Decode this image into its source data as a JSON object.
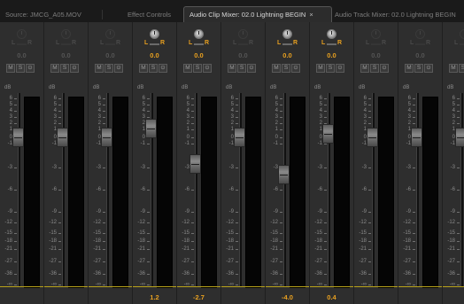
{
  "tabs": [
    {
      "label": "Source: JMCG_A05.MOV",
      "active": false
    },
    {
      "label": "Effect Controls",
      "active": false
    },
    {
      "label": "Audio Clip Mixer: 02.0 Lightning BEGIN",
      "active": true,
      "close": "×"
    },
    {
      "label": "Audio Track Mixer: 02.0 Lightning BEGIN",
      "active": false
    }
  ],
  "colors": {
    "accent": "#e8a020",
    "meter": "#050505",
    "panel": "#2b2b2b"
  },
  "scale_label": "dB",
  "scale_ticks": [
    "6",
    "5",
    "4",
    "3",
    "2",
    "1",
    "0",
    "-1",
    "-3",
    "-6",
    "-9",
    "-12",
    "-15",
    "-18",
    "-21",
    "-27",
    "-36",
    "-∞"
  ],
  "strip_buttons": {
    "mute": "M",
    "solo": "S",
    "record": "⊙"
  },
  "pan_labels": {
    "left": "L",
    "right": "R"
  },
  "strips": [
    {
      "pan": "0.0",
      "enabled": false,
      "volume": "",
      "fader_db": 0
    },
    {
      "pan": "0.0",
      "enabled": false,
      "volume": "",
      "fader_db": 0
    },
    {
      "pan": "0.0",
      "enabled": false,
      "volume": "",
      "fader_db": 0
    },
    {
      "pan": "0.0",
      "enabled": true,
      "volume": "1.2",
      "fader_db": 1.2
    },
    {
      "pan": "0.0",
      "enabled": true,
      "volume": "-2.7",
      "fader_db": -2.7
    },
    {
      "pan": "0.0",
      "enabled": false,
      "volume": "",
      "fader_db": 0
    },
    {
      "pan": "0.0",
      "enabled": true,
      "volume": "-4.0",
      "fader_db": -4.0
    },
    {
      "pan": "0.0",
      "enabled": true,
      "volume": "0.4",
      "fader_db": 0.4
    },
    {
      "pan": "0.0",
      "enabled": false,
      "volume": "",
      "fader_db": 0
    },
    {
      "pan": "0.0",
      "enabled": false,
      "volume": "",
      "fader_db": 0
    },
    {
      "pan": "",
      "enabled": false,
      "volume": "",
      "fader_db": 0
    }
  ]
}
